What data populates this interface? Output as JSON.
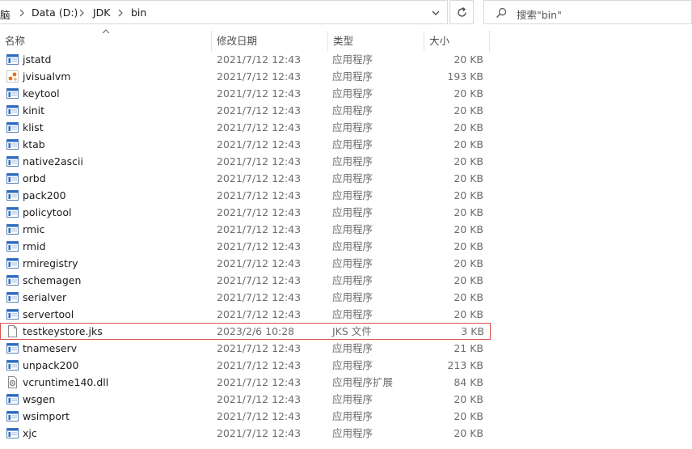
{
  "address": {
    "crumbs": [
      "脑",
      "Data (D:)",
      "JDK",
      "bin"
    ]
  },
  "search": {
    "placeholder": "搜索\"bin\""
  },
  "columns": {
    "name": "名称",
    "date": "修改日期",
    "type": "类型",
    "size": "大小"
  },
  "files": [
    {
      "name": "jstatd",
      "date": "2021/7/12 12:43",
      "type": "应用程序",
      "size": "20 KB",
      "icon": "exe-icon"
    },
    {
      "name": "jvisualvm",
      "date": "2021/7/12 12:43",
      "type": "应用程序",
      "size": "193 KB",
      "icon": "jvisualvm-icon"
    },
    {
      "name": "keytool",
      "date": "2021/7/12 12:43",
      "type": "应用程序",
      "size": "20 KB",
      "icon": "exe-icon"
    },
    {
      "name": "kinit",
      "date": "2021/7/12 12:43",
      "type": "应用程序",
      "size": "20 KB",
      "icon": "exe-icon"
    },
    {
      "name": "klist",
      "date": "2021/7/12 12:43",
      "type": "应用程序",
      "size": "20 KB",
      "icon": "exe-icon"
    },
    {
      "name": "ktab",
      "date": "2021/7/12 12:43",
      "type": "应用程序",
      "size": "20 KB",
      "icon": "exe-icon"
    },
    {
      "name": "native2ascii",
      "date": "2021/7/12 12:43",
      "type": "应用程序",
      "size": "20 KB",
      "icon": "exe-icon"
    },
    {
      "name": "orbd",
      "date": "2021/7/12 12:43",
      "type": "应用程序",
      "size": "20 KB",
      "icon": "exe-icon"
    },
    {
      "name": "pack200",
      "date": "2021/7/12 12:43",
      "type": "应用程序",
      "size": "20 KB",
      "icon": "exe-icon"
    },
    {
      "name": "policytool",
      "date": "2021/7/12 12:43",
      "type": "应用程序",
      "size": "20 KB",
      "icon": "exe-icon"
    },
    {
      "name": "rmic",
      "date": "2021/7/12 12:43",
      "type": "应用程序",
      "size": "20 KB",
      "icon": "exe-icon"
    },
    {
      "name": "rmid",
      "date": "2021/7/12 12:43",
      "type": "应用程序",
      "size": "20 KB",
      "icon": "exe-icon"
    },
    {
      "name": "rmiregistry",
      "date": "2021/7/12 12:43",
      "type": "应用程序",
      "size": "20 KB",
      "icon": "exe-icon"
    },
    {
      "name": "schemagen",
      "date": "2021/7/12 12:43",
      "type": "应用程序",
      "size": "20 KB",
      "icon": "exe-icon"
    },
    {
      "name": "serialver",
      "date": "2021/7/12 12:43",
      "type": "应用程序",
      "size": "20 KB",
      "icon": "exe-icon"
    },
    {
      "name": "servertool",
      "date": "2021/7/12 12:43",
      "type": "应用程序",
      "size": "20 KB",
      "icon": "exe-icon"
    },
    {
      "name": "testkeystore.jks",
      "date": "2023/2/6 10:28",
      "type": "JKS 文件",
      "size": "3 KB",
      "icon": "blank-file-icon",
      "highlighted": true
    },
    {
      "name": "tnameserv",
      "date": "2021/7/12 12:43",
      "type": "应用程序",
      "size": "21 KB",
      "icon": "exe-icon"
    },
    {
      "name": "unpack200",
      "date": "2021/7/12 12:43",
      "type": "应用程序",
      "size": "213 KB",
      "icon": "exe-icon"
    },
    {
      "name": "vcruntime140.dll",
      "date": "2021/7/12 12:43",
      "type": "应用程序扩展",
      "size": "84 KB",
      "icon": "dll-icon"
    },
    {
      "name": "wsgen",
      "date": "2021/7/12 12:43",
      "type": "应用程序",
      "size": "20 KB",
      "icon": "exe-icon"
    },
    {
      "name": "wsimport",
      "date": "2021/7/12 12:43",
      "type": "应用程序",
      "size": "20 KB",
      "icon": "exe-icon"
    },
    {
      "name": "xjc",
      "date": "2021/7/12 12:43",
      "type": "应用程序",
      "size": "20 KB",
      "icon": "exe-icon"
    }
  ],
  "colors": {
    "highlight_border": "#d9534f",
    "exe_blue": "#2b6cc4",
    "jvisualvm_orange": "#e8721c"
  }
}
